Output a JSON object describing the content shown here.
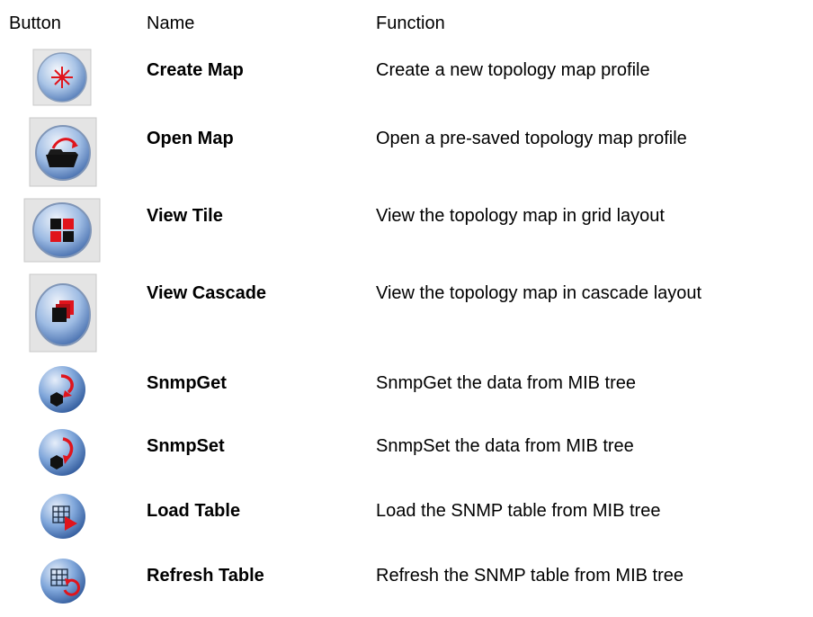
{
  "header": {
    "button": "Button",
    "name": "Name",
    "function": "Function"
  },
  "rows": [
    {
      "icon": "create-map-icon",
      "name": "Create Map",
      "function": "Create a new topology map profile"
    },
    {
      "icon": "open-map-icon",
      "name": "Open Map",
      "function": "Open a pre-saved topology map profile"
    },
    {
      "icon": "view-tile-icon",
      "name": "View Tile",
      "function": "View the topology map in grid layout"
    },
    {
      "icon": "view-cascade-icon",
      "name": "View Cascade",
      "function": "View the topology map in cascade layout"
    },
    {
      "icon": "snmp-get-icon",
      "name": "SnmpGet",
      "function": "SnmpGet the data from MIB tree"
    },
    {
      "icon": "snmp-set-icon",
      "name": "SnmpSet",
      "function": "SnmpSet the data from MIB tree"
    },
    {
      "icon": "load-table-icon",
      "name": "Load Table",
      "function": "Load the SNMP table from MIB tree"
    },
    {
      "icon": "refresh-table-icon",
      "name": "Refresh Table",
      "function": "Refresh the SNMP table from MIB tree"
    }
  ],
  "colors": {
    "text": "#000000",
    "accent_red": "#e0141c",
    "button_blue": "#5f8fcf",
    "button_frame": "#c8c8c8"
  }
}
